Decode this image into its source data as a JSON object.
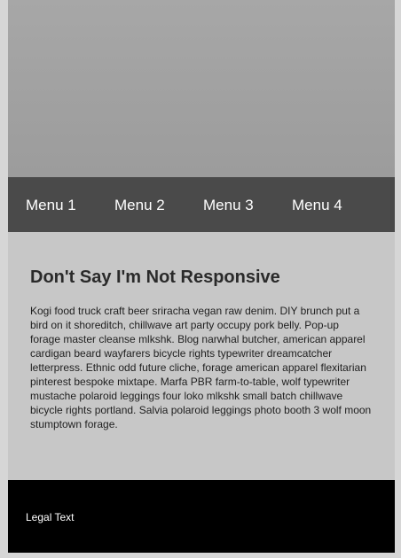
{
  "nav": {
    "items": [
      {
        "label": "Menu 1"
      },
      {
        "label": "Menu 2"
      },
      {
        "label": "Menu 3"
      },
      {
        "label": "Menu 4"
      }
    ]
  },
  "main": {
    "title": "Don't Say I'm Not Responsive",
    "body": "Kogi food truck craft beer sriracha vegan raw denim. DIY brunch put a bird on it shoreditch, chillwave art party occupy pork belly. Pop-up forage master cleanse mlkshk. Blog narwhal butcher, american apparel cardigan beard wayfarers bicycle rights typewriter dreamcatcher letterpress. Ethnic odd future cliche, forage american apparel flexitarian pinterest bespoke mixtape. Marfa PBR farm-to-table, wolf typewriter mustache polaroid leggings four loko mlkshk small batch chillwave bicycle rights portland. Salvia polaroid leggings photo booth 3 wolf moon stumptown forage."
  },
  "footer": {
    "text": "Legal Text"
  },
  "colors": {
    "hero": "#a0a0a0",
    "nav": "#4a4a4a",
    "content": "#c7c7c7",
    "footer": "#000000"
  }
}
